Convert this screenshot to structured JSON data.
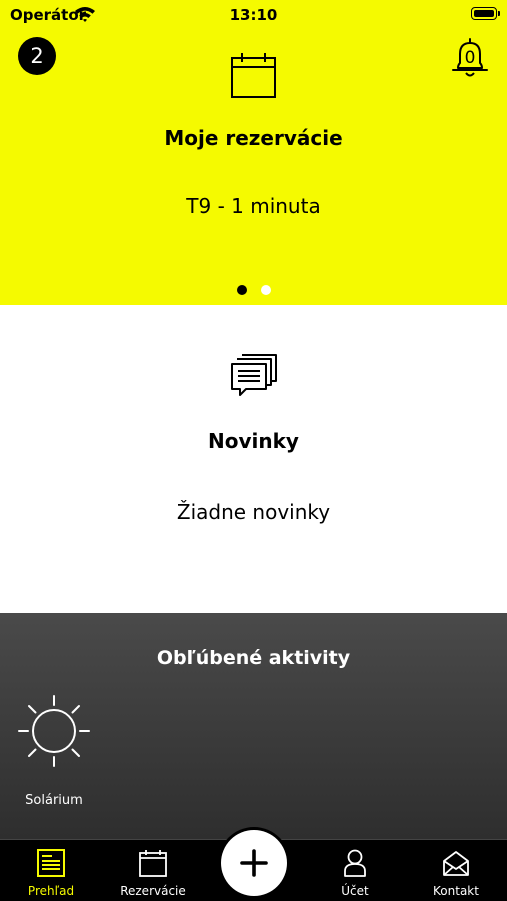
{
  "status_bar": {
    "carrier": "Operátor",
    "time": "13:10"
  },
  "header": {
    "notification_badge": "2",
    "bell_count": "0"
  },
  "reservations": {
    "title": "Moje rezervácie",
    "value": "T9 - 1 minuta",
    "carousel_pages": 2,
    "active_page": 1
  },
  "news": {
    "title": "Novinky",
    "value": "Žiadne novinky"
  },
  "favorites": {
    "title": "Obľúbené aktivity",
    "items": [
      {
        "label": "Solárium",
        "icon": "sun-icon"
      }
    ]
  },
  "tabbar": {
    "items": [
      {
        "label": "Prehľad",
        "icon": "overview-icon",
        "active": true
      },
      {
        "label": "Rezervácie",
        "icon": "calendar-icon",
        "active": false
      },
      {
        "label": "Účet",
        "icon": "person-icon",
        "active": false
      },
      {
        "label": "Kontakt",
        "icon": "envelope-icon",
        "active": false
      }
    ],
    "add_icon": "plus-icon"
  },
  "colors": {
    "accent": "#f5fa00",
    "dark": "#3a3a3a",
    "tabbar": "#000000"
  }
}
